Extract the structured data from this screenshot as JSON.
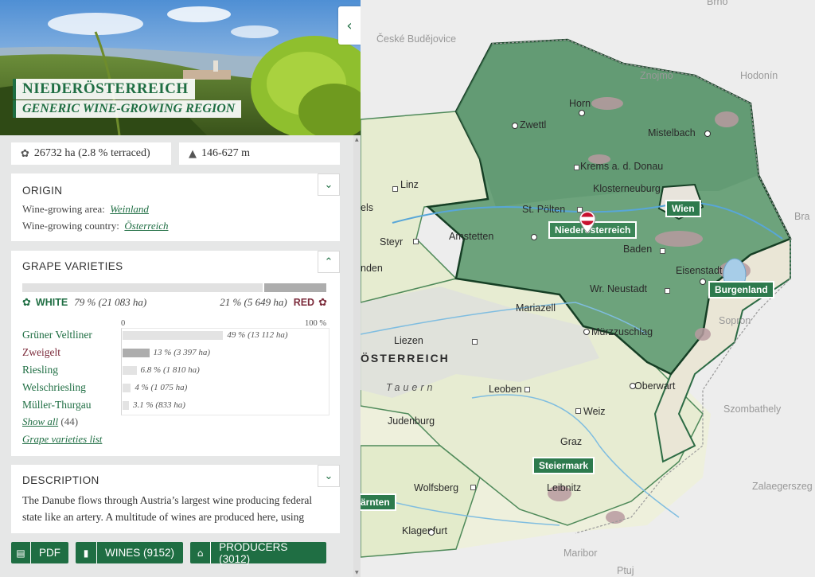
{
  "region": {
    "title": "NIEDERÖSTERREICH",
    "subtitle": "GENERIC WINE-GROWING REGION"
  },
  "stats": {
    "area": "26732 ha (2.8 % terraced)",
    "altitude": "146-627 m"
  },
  "origin": {
    "heading": "ORIGIN",
    "area_label": "Wine-growing area:",
    "area_value": "Weinland",
    "country_label": "Wine-growing country:",
    "country_value": "Österreich"
  },
  "grapes": {
    "heading": "GRAPE VARIETIES",
    "white_label": "WHITE",
    "white_value": "79 % (21 083 ha)",
    "white_share": 0.79,
    "red_label": "RED",
    "red_value": "21 % (5 649 ha)",
    "scale_min": "0",
    "scale_max": "100 %",
    "varieties": [
      {
        "name": "Grüner Veltliner",
        "color": "white",
        "percent": 49,
        "label": "49 % (13 112 ha)"
      },
      {
        "name": "Zweigelt",
        "color": "red",
        "percent": 13,
        "label": "13 % (3 397 ha)"
      },
      {
        "name": "Riesling",
        "color": "white",
        "percent": 6.8,
        "label": "6.8 % (1 810 ha)"
      },
      {
        "name": "Welschriesling",
        "color": "white",
        "percent": 4,
        "label": "4 % (1 075 ha)"
      },
      {
        "name": "Müller-Thurgau",
        "color": "white",
        "percent": 3.1,
        "label": "3.1 % (833 ha)"
      }
    ],
    "show_all": "Show all",
    "show_all_count": "(44)",
    "list_link": "Grape varieties list"
  },
  "description": {
    "heading": "DESCRIPTION",
    "text": "The Danube flows through Austria’s largest wine producing federal state like an artery. A multitude of wines are produced here, using"
  },
  "buttons": {
    "pdf": "PDF",
    "wines": "WINES (9152)",
    "producers": "PRODUCERS (3012)"
  },
  "map": {
    "labels": {
      "brno": "Brno",
      "ceske": "České Budějovice",
      "znojmo": "Znojmo",
      "hodonin": "Hodonín",
      "horn": "Horn",
      "zwettl": "Zwettl",
      "mistelbach": "Mistelbach",
      "krems": "Krems a. d. Donau",
      "klosterneuburg": "Klosterneuburg",
      "linz": "Linz",
      "stpoelten": "St. Pölten",
      "amstetten": "Amstetten",
      "steyr": "Steyr",
      "baden": "Baden",
      "eisenstadt": "Eisenstadt",
      "wrneustadt": "Wr. Neustadt",
      "mariazell": "Mariazell",
      "muerz": "Mürzzuschlag",
      "liezen": "Liezen",
      "sopron": "Sopron",
      "oesterreich": "ÖSTERREICH",
      "tauern": "Tauern",
      "leoben": "Leoben",
      "oberwart": "Oberwart",
      "weiz": "Weiz",
      "judenburg": "Judenburg",
      "szombathely": "Szombathely",
      "graz": "Graz",
      "zalaegerszeg": "Zalaegerszeg",
      "wolfsberg": "Wolfsberg",
      "leibnitz": "Leibnitz",
      "klagenfurt": "Klagenfurt",
      "maribor": "Maribor",
      "ptuj": "Ptuj",
      "els": "els",
      "nden": "nden",
      "bra": "Bra"
    },
    "tags": {
      "wien": "Wien",
      "noe": "Niederösterreich",
      "burgenland": "Burgenland",
      "steiermark": "Steiermark",
      "kaernten": "ärnten"
    }
  },
  "colors": {
    "accent": "#1f6e43",
    "region": "#6da37c",
    "red_wine": "#7b2a3a"
  }
}
